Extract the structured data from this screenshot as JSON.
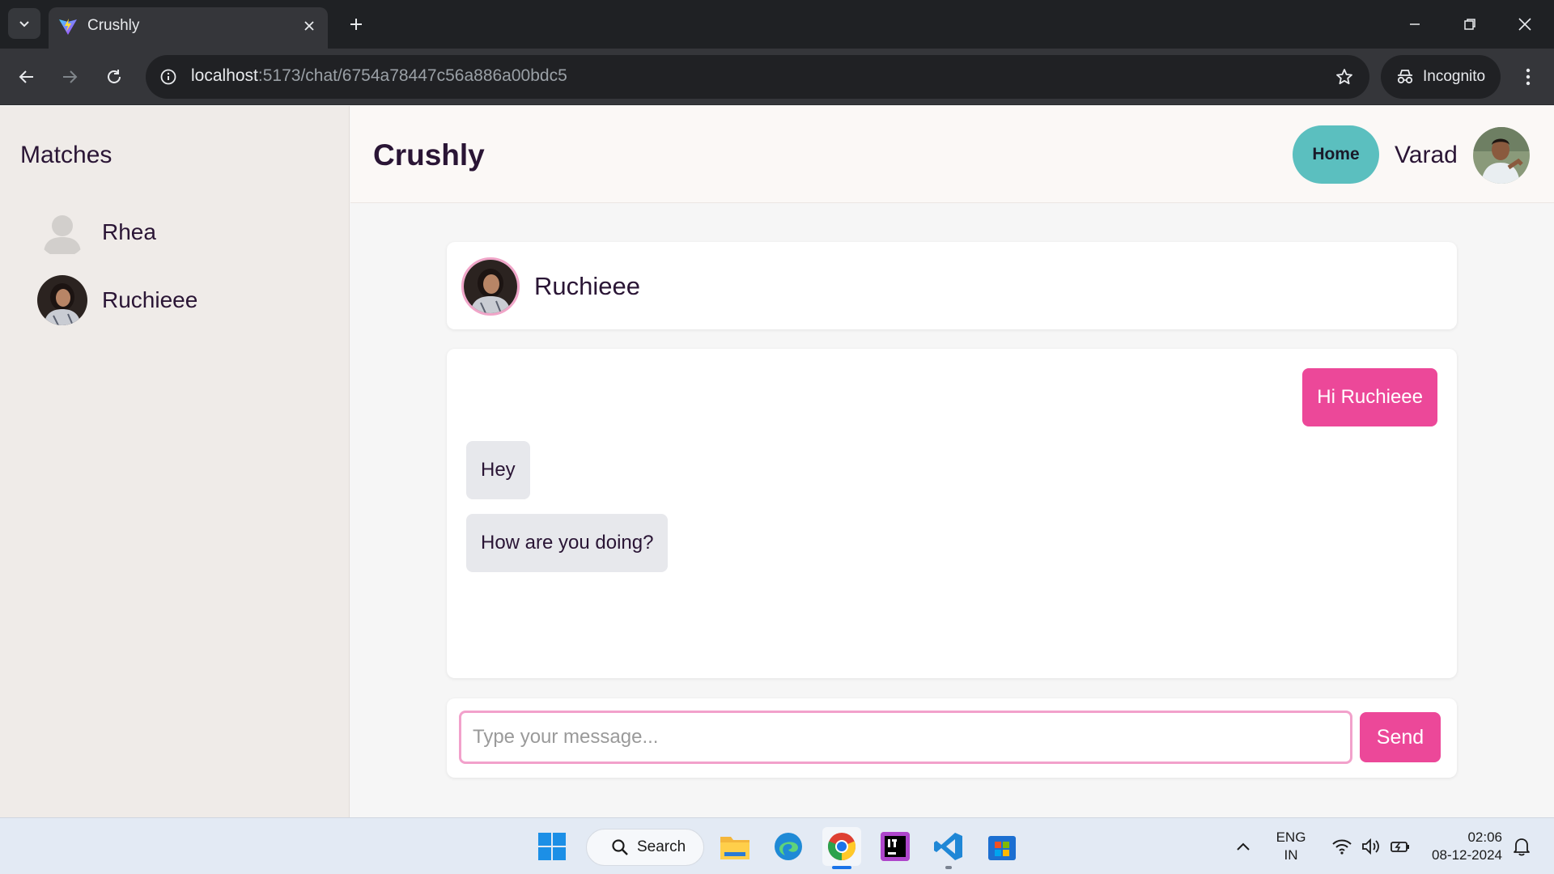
{
  "browser": {
    "tab_title": "Crushly",
    "url_host": "localhost",
    "url_rest": ":5173/chat/6754a78447c56a886a00bdc5",
    "incognito_label": "Incognito"
  },
  "sidebar": {
    "title": "Matches",
    "matches": [
      {
        "name": "Rhea"
      },
      {
        "name": "Ruchieee"
      }
    ]
  },
  "header": {
    "brand": "Crushly",
    "home_label": "Home",
    "user_name": "Varad"
  },
  "chat": {
    "partner_name": "Ruchieee",
    "messages": [
      {
        "text": "Hi Ruchieee",
        "direction": "outgoing"
      },
      {
        "text": "Hey",
        "direction": "incoming"
      },
      {
        "text": "How are you doing?",
        "direction": "incoming"
      }
    ],
    "input_placeholder": "Type your message...",
    "input_value": "",
    "send_label": "Send"
  },
  "taskbar": {
    "search_label": "Search",
    "lang_top": "ENG",
    "lang_bottom": "IN",
    "time": "02:06",
    "date": "08-12-2024"
  },
  "colors": {
    "accent_pink": "#ec4899",
    "accent_teal": "#5bbfbf",
    "text_dark": "#2a1535"
  },
  "icons": [
    "tab-list-icon",
    "vite-favicon-icon",
    "close-icon",
    "plus-icon",
    "minimize-icon",
    "restore-icon",
    "back-icon",
    "forward-icon",
    "reload-icon",
    "info-icon",
    "star-icon",
    "incognito-icon",
    "kebab-icon",
    "windows-start-icon",
    "search-icon",
    "file-explorer-icon",
    "edge-icon",
    "chrome-icon",
    "jetbrains-icon",
    "vscode-icon",
    "store-icon",
    "chevron-up-icon",
    "wifi-icon",
    "volume-icon",
    "battery-icon",
    "bell-icon"
  ]
}
